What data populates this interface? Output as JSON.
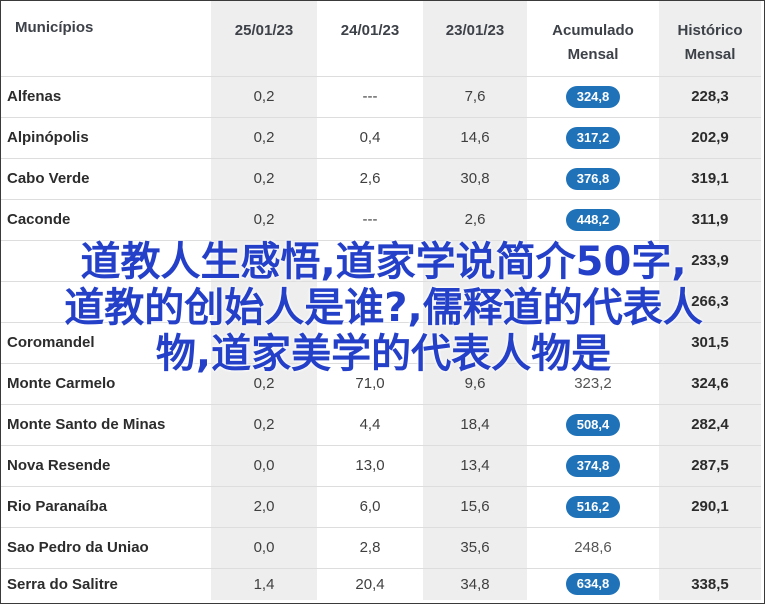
{
  "columns": {
    "name": "Municípios",
    "d1": "25/01/23",
    "d2": "24/01/23",
    "d3": "23/01/23",
    "acumulado_line1": "Acumulado",
    "acumulado_line2": "Mensal",
    "historico_line1": "Histórico",
    "historico_line2": "Mensal"
  },
  "rows": [
    {
      "name": "Alfenas",
      "d1": "0,2",
      "d2": "---",
      "d3": "7,6",
      "acumulado": "324,8",
      "acumulado_badge": true,
      "historico": "228,3"
    },
    {
      "name": "Alpinópolis",
      "d1": "0,2",
      "d2": "0,4",
      "d3": "14,6",
      "acumulado": "317,2",
      "acumulado_badge": true,
      "historico": "202,9"
    },
    {
      "name": "Cabo Verde",
      "d1": "0,2",
      "d2": "2,6",
      "d3": "30,8",
      "acumulado": "376,8",
      "acumulado_badge": true,
      "historico": "319,1"
    },
    {
      "name": "Caconde",
      "d1": "0,2",
      "d2": "---",
      "d3": "2,6",
      "acumulado": "448,2",
      "acumulado_badge": true,
      "historico": "311,9"
    },
    {
      "name": "",
      "d1": "",
      "d2": "",
      "d3": "",
      "acumulado": "",
      "acumulado_badge": true,
      "historico": "233,9"
    },
    {
      "name": "",
      "d1": "",
      "d2": "",
      "d3": "",
      "acumulado": "",
      "acumulado_badge": true,
      "historico": "266,3"
    },
    {
      "name": "Coromandel",
      "d1": "",
      "d2": "",
      "d3": "",
      "acumulado": "",
      "acumulado_badge": true,
      "historico": "301,5"
    },
    {
      "name": "Monte Carmelo",
      "d1": "0,2",
      "d2": "71,0",
      "d3": "9,6",
      "acumulado": "323,2",
      "acumulado_badge": false,
      "historico": "324,6"
    },
    {
      "name": "Monte Santo de Minas",
      "d1": "0,2",
      "d2": "4,4",
      "d3": "18,4",
      "acumulado": "508,4",
      "acumulado_badge": true,
      "historico": "282,4"
    },
    {
      "name": "Nova Resende",
      "d1": "0,0",
      "d2": "13,0",
      "d3": "13,4",
      "acumulado": "374,8",
      "acumulado_badge": true,
      "historico": "287,5"
    },
    {
      "name": "Rio Paranaíba",
      "d1": "2,0",
      "d2": "6,0",
      "d3": "15,6",
      "acumulado": "516,2",
      "acumulado_badge": true,
      "historico": "290,1"
    },
    {
      "name": "Sao Pedro da Uniao",
      "d1": "0,0",
      "d2": "2,8",
      "d3": "35,6",
      "acumulado": "248,6",
      "acumulado_badge": false,
      "historico": ""
    },
    {
      "name": "Serra do Salitre",
      "d1": "1,4",
      "d2": "20,4",
      "d3": "34,8",
      "acumulado": "634,8",
      "acumulado_badge": true,
      "historico": "338,5"
    }
  ],
  "overlay": {
    "line1": "道教人生感悟,道家学说简介50字,",
    "line2": "道教的创始人是谁?,儒释道的代表人",
    "line3": "物,道家美学的代表人物是"
  },
  "colors": {
    "badge": "#1f72b8",
    "shaded_column": "#eeeeee",
    "overlay_text": "#2440c9"
  }
}
